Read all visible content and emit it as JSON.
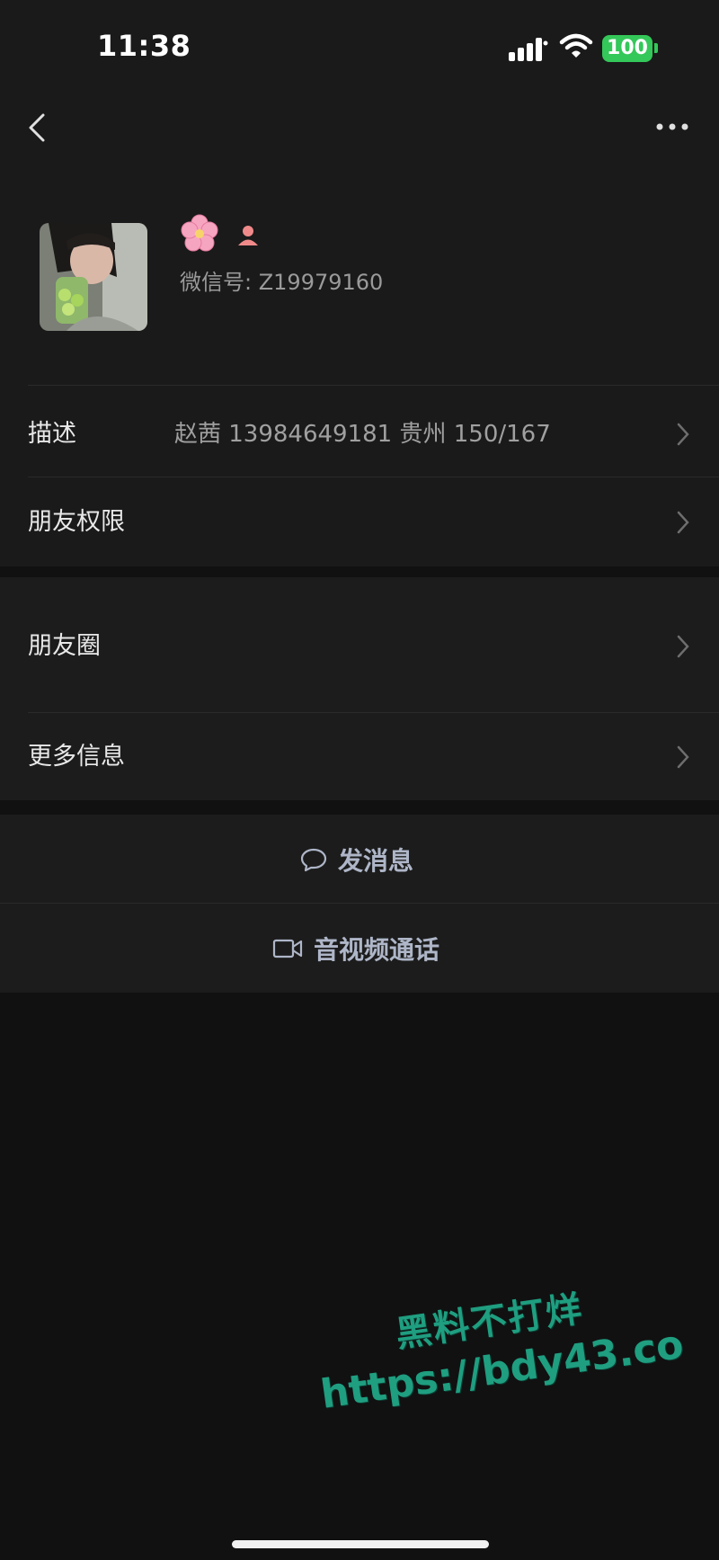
{
  "status_bar": {
    "time": "11:38",
    "battery": "100",
    "icons": [
      "signal-icon",
      "wifi-icon",
      "battery-icon"
    ]
  },
  "nav": {
    "back_icon": "chevron-left-icon",
    "more_icon": "more-dots-icon"
  },
  "profile": {
    "emoji_icons": [
      "cherry-blossom-icon",
      "female-gender-icon"
    ],
    "wechat_id": "微信号: Z19979160"
  },
  "rows": {
    "description_label": "描述",
    "description_value": "赵茜 13984649181 贵州 150/167",
    "permissions_label": "朋友权限",
    "moments_label": "朋友圈",
    "more_info_label": "更多信息"
  },
  "actions": {
    "message_label": "发消息",
    "call_label": "音视频通话"
  },
  "watermark": {
    "line1": "黑料不打烊",
    "line2": "https://bdy43.co"
  },
  "colors": {
    "background": "#111111",
    "panel": "#1c1c1c",
    "battery_green": "#34c759",
    "action_text": "#aeb6c8",
    "watermark": "#1f9e80"
  }
}
